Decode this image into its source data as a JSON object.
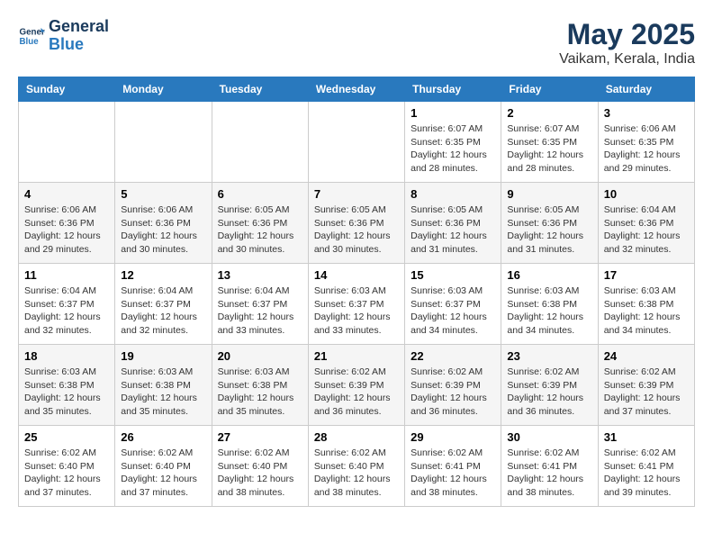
{
  "header": {
    "logo_line1": "General",
    "logo_line2": "Blue",
    "title": "May 2025",
    "subtitle": "Vaikam, Kerala, India"
  },
  "days_of_week": [
    "Sunday",
    "Monday",
    "Tuesday",
    "Wednesday",
    "Thursday",
    "Friday",
    "Saturday"
  ],
  "weeks": [
    [
      {
        "num": "",
        "info": ""
      },
      {
        "num": "",
        "info": ""
      },
      {
        "num": "",
        "info": ""
      },
      {
        "num": "",
        "info": ""
      },
      {
        "num": "1",
        "info": "Sunrise: 6:07 AM\nSunset: 6:35 PM\nDaylight: 12 hours\nand 28 minutes."
      },
      {
        "num": "2",
        "info": "Sunrise: 6:07 AM\nSunset: 6:35 PM\nDaylight: 12 hours\nand 28 minutes."
      },
      {
        "num": "3",
        "info": "Sunrise: 6:06 AM\nSunset: 6:35 PM\nDaylight: 12 hours\nand 29 minutes."
      }
    ],
    [
      {
        "num": "4",
        "info": "Sunrise: 6:06 AM\nSunset: 6:36 PM\nDaylight: 12 hours\nand 29 minutes."
      },
      {
        "num": "5",
        "info": "Sunrise: 6:06 AM\nSunset: 6:36 PM\nDaylight: 12 hours\nand 30 minutes."
      },
      {
        "num": "6",
        "info": "Sunrise: 6:05 AM\nSunset: 6:36 PM\nDaylight: 12 hours\nand 30 minutes."
      },
      {
        "num": "7",
        "info": "Sunrise: 6:05 AM\nSunset: 6:36 PM\nDaylight: 12 hours\nand 30 minutes."
      },
      {
        "num": "8",
        "info": "Sunrise: 6:05 AM\nSunset: 6:36 PM\nDaylight: 12 hours\nand 31 minutes."
      },
      {
        "num": "9",
        "info": "Sunrise: 6:05 AM\nSunset: 6:36 PM\nDaylight: 12 hours\nand 31 minutes."
      },
      {
        "num": "10",
        "info": "Sunrise: 6:04 AM\nSunset: 6:36 PM\nDaylight: 12 hours\nand 32 minutes."
      }
    ],
    [
      {
        "num": "11",
        "info": "Sunrise: 6:04 AM\nSunset: 6:37 PM\nDaylight: 12 hours\nand 32 minutes."
      },
      {
        "num": "12",
        "info": "Sunrise: 6:04 AM\nSunset: 6:37 PM\nDaylight: 12 hours\nand 32 minutes."
      },
      {
        "num": "13",
        "info": "Sunrise: 6:04 AM\nSunset: 6:37 PM\nDaylight: 12 hours\nand 33 minutes."
      },
      {
        "num": "14",
        "info": "Sunrise: 6:03 AM\nSunset: 6:37 PM\nDaylight: 12 hours\nand 33 minutes."
      },
      {
        "num": "15",
        "info": "Sunrise: 6:03 AM\nSunset: 6:37 PM\nDaylight: 12 hours\nand 34 minutes."
      },
      {
        "num": "16",
        "info": "Sunrise: 6:03 AM\nSunset: 6:38 PM\nDaylight: 12 hours\nand 34 minutes."
      },
      {
        "num": "17",
        "info": "Sunrise: 6:03 AM\nSunset: 6:38 PM\nDaylight: 12 hours\nand 34 minutes."
      }
    ],
    [
      {
        "num": "18",
        "info": "Sunrise: 6:03 AM\nSunset: 6:38 PM\nDaylight: 12 hours\nand 35 minutes."
      },
      {
        "num": "19",
        "info": "Sunrise: 6:03 AM\nSunset: 6:38 PM\nDaylight: 12 hours\nand 35 minutes."
      },
      {
        "num": "20",
        "info": "Sunrise: 6:03 AM\nSunset: 6:38 PM\nDaylight: 12 hours\nand 35 minutes."
      },
      {
        "num": "21",
        "info": "Sunrise: 6:02 AM\nSunset: 6:39 PM\nDaylight: 12 hours\nand 36 minutes."
      },
      {
        "num": "22",
        "info": "Sunrise: 6:02 AM\nSunset: 6:39 PM\nDaylight: 12 hours\nand 36 minutes."
      },
      {
        "num": "23",
        "info": "Sunrise: 6:02 AM\nSunset: 6:39 PM\nDaylight: 12 hours\nand 36 minutes."
      },
      {
        "num": "24",
        "info": "Sunrise: 6:02 AM\nSunset: 6:39 PM\nDaylight: 12 hours\nand 37 minutes."
      }
    ],
    [
      {
        "num": "25",
        "info": "Sunrise: 6:02 AM\nSunset: 6:40 PM\nDaylight: 12 hours\nand 37 minutes."
      },
      {
        "num": "26",
        "info": "Sunrise: 6:02 AM\nSunset: 6:40 PM\nDaylight: 12 hours\nand 37 minutes."
      },
      {
        "num": "27",
        "info": "Sunrise: 6:02 AM\nSunset: 6:40 PM\nDaylight: 12 hours\nand 38 minutes."
      },
      {
        "num": "28",
        "info": "Sunrise: 6:02 AM\nSunset: 6:40 PM\nDaylight: 12 hours\nand 38 minutes."
      },
      {
        "num": "29",
        "info": "Sunrise: 6:02 AM\nSunset: 6:41 PM\nDaylight: 12 hours\nand 38 minutes."
      },
      {
        "num": "30",
        "info": "Sunrise: 6:02 AM\nSunset: 6:41 PM\nDaylight: 12 hours\nand 38 minutes."
      },
      {
        "num": "31",
        "info": "Sunrise: 6:02 AM\nSunset: 6:41 PM\nDaylight: 12 hours\nand 39 minutes."
      }
    ]
  ]
}
